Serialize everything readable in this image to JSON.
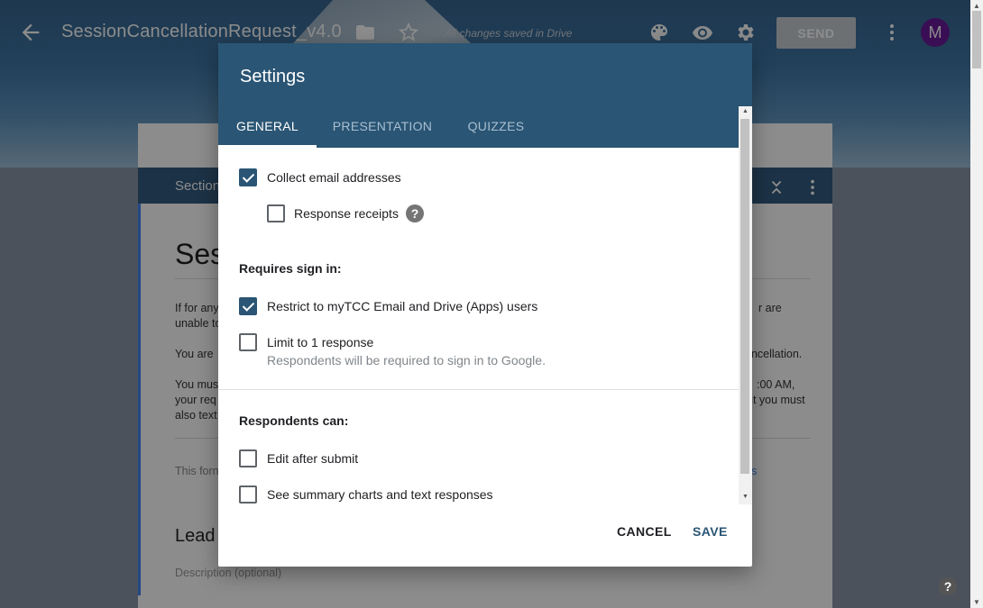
{
  "header": {
    "doc_title": "SessionCancellationRequest_v4.0",
    "saved_status": "All changes saved in Drive",
    "send_label": "SEND",
    "avatar_letter": "M",
    "icons": [
      "back-arrow-icon",
      "folder-icon",
      "star-icon",
      "palette-icon",
      "eye-icon",
      "gear-icon",
      "more-vert-icon"
    ]
  },
  "background_form": {
    "section_label": "Section",
    "title_fragment": "Ses",
    "para1_left_a": "If for any",
    "para1_left_b": "unable to",
    "para1_right": "r are",
    "para2_left": "You are",
    "para2_right": "ancellation.",
    "para3_left_a": "You mus",
    "para3_left_b": "your req",
    "para3_left_c": "also text",
    "para3_right_a": ":00 AM,",
    "para3_right_b": "ut you must",
    "footer_fragment": "This forn",
    "footer_link_fragment": "ns",
    "heading2_fragment": "Lead",
    "description_placeholder": "Description (optional)"
  },
  "dialog": {
    "title": "Settings",
    "tabs": [
      {
        "label": "GENERAL",
        "active": true
      },
      {
        "label": "PRESENTATION",
        "active": false
      },
      {
        "label": "QUIZZES",
        "active": false
      }
    ],
    "options": {
      "collect_email": {
        "label": "Collect email addresses",
        "checked": true
      },
      "response_receipts": {
        "label": "Response receipts",
        "checked": false
      },
      "requires_sign_in_label": "Requires sign in:",
      "restrict_users": {
        "label": "Restrict to myTCC Email and Drive (Apps) users",
        "checked": true
      },
      "limit_one": {
        "label": "Limit to 1 response",
        "checked": false,
        "sub": "Respondents will be required to sign in to Google."
      },
      "respondents_can_label": "Respondents can:",
      "edit_after_submit": {
        "label": "Edit after submit",
        "checked": false
      },
      "see_summary": {
        "label": "See summary charts and text responses",
        "checked": false
      }
    },
    "cancel_label": "CANCEL",
    "save_label": "SAVE"
  },
  "colors": {
    "dialog_header": "#2a5574",
    "checkbox_checked": "#2a5574",
    "avatar": "#6a1b9a"
  }
}
